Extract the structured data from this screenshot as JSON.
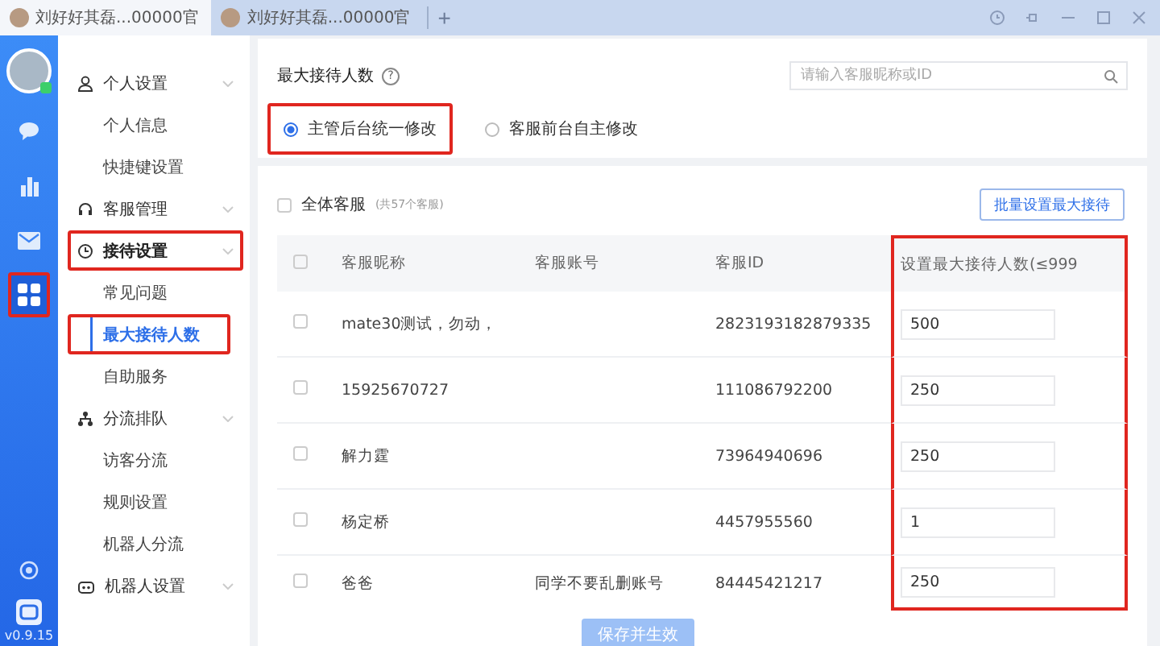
{
  "tabs": [
    {
      "label": "刘好好其磊...00000官",
      "selected": true
    },
    {
      "label": "刘好好其磊...00000官",
      "selected": false
    }
  ],
  "new_tab": "+",
  "rail": {
    "items": [
      {
        "kind": "chat",
        "selected": false,
        "annotated": false
      },
      {
        "kind": "chart",
        "selected": false,
        "annotated": false
      },
      {
        "kind": "mail",
        "selected": false,
        "annotated": false
      },
      {
        "kind": "apps",
        "selected": true,
        "annotated": true
      }
    ],
    "version": "v0.9.15"
  },
  "sidebar": {
    "groups": [
      {
        "kind": "person",
        "label": "个人设置",
        "selected": false,
        "annotated": false,
        "children": [
          {
            "label": "个人信息",
            "selected": false,
            "annotated": false
          },
          {
            "label": "快捷键设置",
            "selected": false,
            "annotated": false
          }
        ]
      },
      {
        "kind": "headset",
        "label": "客服管理",
        "selected": false,
        "annotated": false
      },
      {
        "kind": "reception",
        "label": "接待设置",
        "selected": true,
        "annotated": true,
        "children": [
          {
            "label": "常见问题",
            "selected": false,
            "annotated": false
          },
          {
            "label": "最大接待人数",
            "selected": true,
            "annotated": true
          },
          {
            "label": "自助服务",
            "selected": false,
            "annotated": false
          }
        ]
      },
      {
        "kind": "tree",
        "label": "分流排队",
        "selected": false,
        "annotated": false,
        "children": [
          {
            "label": "访客分流",
            "selected": false,
            "annotated": false
          },
          {
            "label": "规则设置",
            "selected": false,
            "annotated": false
          },
          {
            "label": "机器人分流",
            "selected": false,
            "annotated": false
          }
        ]
      },
      {
        "kind": "robot",
        "label": "机器人设置",
        "selected": false,
        "annotated": false
      }
    ]
  },
  "header": {
    "title": "最大接待人数",
    "help": "?",
    "search": {
      "placeholder": "请输入客服昵称或ID"
    },
    "options": [
      {
        "label": "主管后台统一修改",
        "selected": true,
        "annotated": true
      },
      {
        "label": "客服前台自主修改",
        "selected": false,
        "annotated": false
      }
    ]
  },
  "list": {
    "select_all": {
      "label": "全体客服",
      "count": "(共57个客服)",
      "checked": false
    },
    "batch_button": "批量设置最大接待",
    "table": {
      "header_checked": false,
      "columns": [
        {
          "label": "客服昵称",
          "annotated": false
        },
        {
          "label": "客服账号",
          "annotated": false
        },
        {
          "label": "客服ID",
          "annotated": false
        },
        {
          "label": "设置最大接待人数(≤999",
          "annotated": true
        }
      ],
      "rows": [
        {
          "checked": false,
          "name": "mate30测试，勿动，",
          "id": "2823193182879335",
          "max": "500"
        },
        {
          "checked": false,
          "name": "15925670727",
          "id": "111086792200",
          "max": "250"
        },
        {
          "checked": false,
          "name": "解力霆",
          "id": "73964940696",
          "max": "250"
        },
        {
          "checked": false,
          "name": "杨定桥",
          "id": "4457955560",
          "max": "1"
        },
        {
          "checked": false,
          "name": "爸爸",
          "account": "同学不要乱删账号",
          "id": "84445421217",
          "max": "250"
        }
      ]
    },
    "save_button": {
      "label": "保存并生效",
      "disabled": true
    }
  }
}
